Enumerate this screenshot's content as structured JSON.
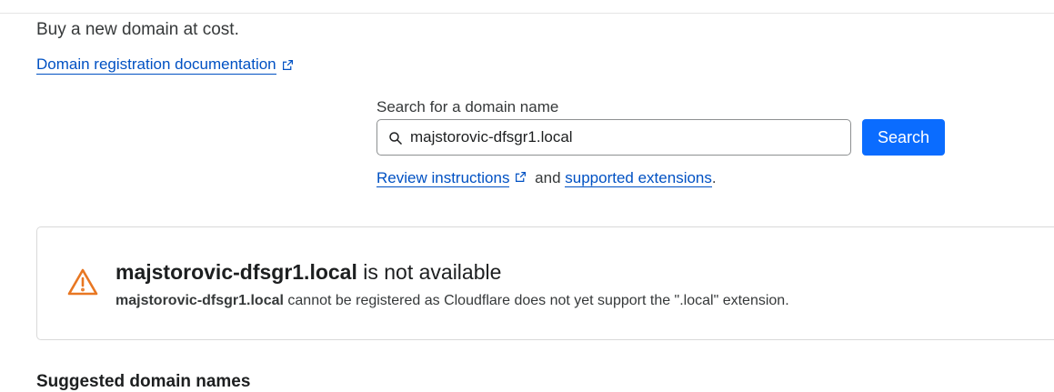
{
  "header": {
    "subtitle": "Buy a new domain at cost.",
    "doc_link": "Domain registration documentation"
  },
  "search": {
    "label": "Search for a domain name",
    "value": "majstorovic-dfsgr1.local",
    "placeholder": "",
    "button_label": "Search"
  },
  "hint": {
    "review_link": "Review instructions",
    "and_text": " and ",
    "extensions_link": "supported extensions",
    "period": "."
  },
  "alert": {
    "domain": "majstorovic-dfsgr1.local",
    "status_text": " is not available",
    "desc_domain": "majstorovic-dfsgr1.local",
    "desc_text": " cannot be registered as Cloudflare does not yet support the \".local\" extension.",
    "icon": "warning-triangle-icon",
    "icon_color": "#e87722"
  },
  "suggestions": {
    "heading": "Suggested domain names"
  },
  "colors": {
    "link": "#0051c3",
    "primary_button": "#0a6cff",
    "warning": "#e87722"
  }
}
